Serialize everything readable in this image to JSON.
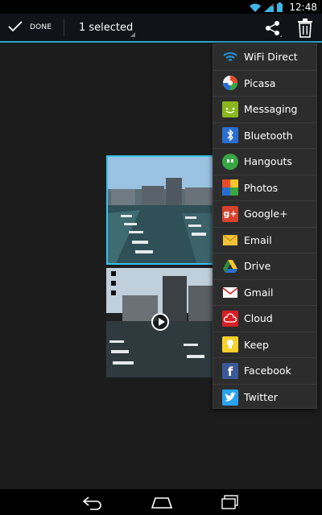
{
  "status_bar": {
    "time": "12:48"
  },
  "action_bar": {
    "done_label": "DONE",
    "selection_label": "1 selected"
  },
  "share_menu": {
    "items": [
      {
        "label": "WiFi Direct",
        "icon": "wifi-direct-icon",
        "color": "#1e90d6"
      },
      {
        "label": "Picasa",
        "icon": "picasa-icon",
        "color": "#e84a2c"
      },
      {
        "label": "Messaging",
        "icon": "messaging-icon",
        "color": "#8ab71e"
      },
      {
        "label": "Bluetooth",
        "icon": "bluetooth-icon",
        "color": "#2a6fcf"
      },
      {
        "label": "Hangouts",
        "icon": "hangouts-icon",
        "color": "#3aa543"
      },
      {
        "label": "Photos",
        "icon": "photos-icon",
        "color": "#e0a51d"
      },
      {
        "label": "Google+",
        "icon": "google-plus-icon",
        "color": "#d6422e"
      },
      {
        "label": "Email",
        "icon": "email-icon",
        "color": "#f2c33a"
      },
      {
        "label": "Drive",
        "icon": "drive-icon",
        "color": "#2f8d3e"
      },
      {
        "label": "Gmail",
        "icon": "gmail-icon",
        "color": "#ffffff"
      },
      {
        "label": "Cloud",
        "icon": "cloud-icon",
        "color": "#d61f26"
      },
      {
        "label": "Keep",
        "icon": "keep-icon",
        "color": "#f7d02c"
      },
      {
        "label": "Facebook",
        "icon": "facebook-icon",
        "color": "#3b5998"
      },
      {
        "label": "Twitter",
        "icon": "twitter-icon",
        "color": "#2aa3ef"
      }
    ]
  },
  "colors": {
    "accent": "#2aa6cc",
    "menu_background": "#2c2c2c"
  }
}
